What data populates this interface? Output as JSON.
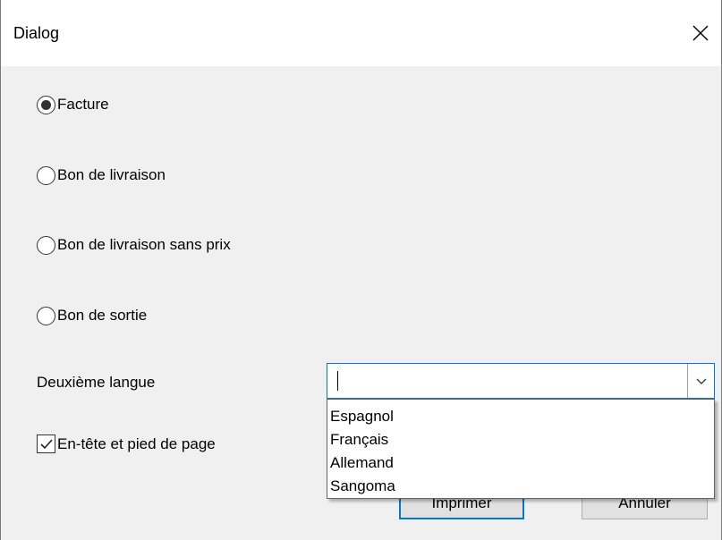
{
  "window": {
    "title": "Dialog",
    "close_icon": "close-icon"
  },
  "radios": [
    {
      "label": "Facture",
      "selected": true
    },
    {
      "label": "Bon de livraison",
      "selected": false
    },
    {
      "label": "Bon de livraison sans prix",
      "selected": false
    },
    {
      "label": "Bon de sortie",
      "selected": false
    }
  ],
  "language": {
    "label": "Deuxième langue",
    "value": "",
    "options": [
      "Espagnol",
      "Français",
      "Allemand",
      "Sangoma"
    ]
  },
  "header_footer": {
    "label": "En-tête et pied de page",
    "checked": true
  },
  "buttons": {
    "print": "Imprimer",
    "cancel": "Annuler"
  },
  "colors": {
    "accent": "#0078d7",
    "background": "#f0f0f0",
    "button": "#e1e1e1"
  }
}
